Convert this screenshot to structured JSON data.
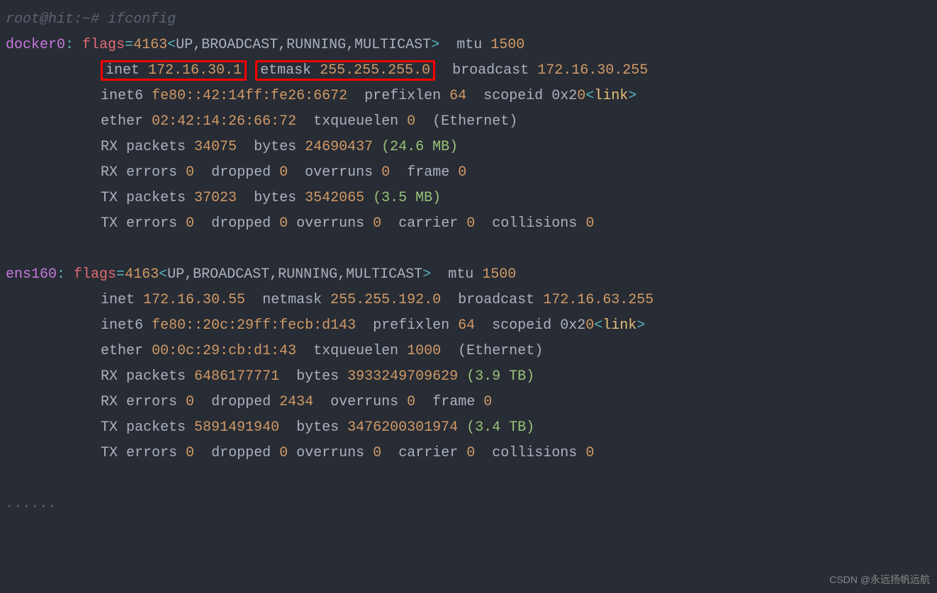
{
  "prompt": {
    "user": "root@hit",
    "path": "~",
    "symbol": "#",
    "command": "ifconfig"
  },
  "ifaces": [
    {
      "name": "docker0",
      "flags_label": "flags",
      "flags_num": "4163",
      "flags_list": "UP,BROADCAST,RUNNING,MULTICAST",
      "mtu_label": "mtu",
      "mtu": "1500",
      "inet_label": "inet",
      "inet": "172.16.30.1",
      "netmask_label": "netmask",
      "netmask_frag": "etmask",
      "netmask": "255.255.255.0",
      "broadcast_label": "broadcast",
      "broadcast": "172.16.30.255",
      "inet6_label": "inet6",
      "inet6": "fe80::42:14ff:fe26:6672",
      "prefixlen_label": "prefixlen",
      "prefixlen": "64",
      "scopeid_label": "scopeid",
      "scopeid_pre": "0x2",
      "scopeid_z": "0",
      "link_lt": "<",
      "link_text": "link",
      "link_gt": ">",
      "ether_label": "ether",
      "ether": "02:42:14:26:66:72",
      "txql_label": "txqueuelen",
      "txql": "0",
      "media": "(Ethernet)",
      "rx_packets_label": "RX packets",
      "rx_packets": "34075",
      "rx_bytes_label": "bytes",
      "rx_bytes": "24690437",
      "rx_bytes_h": "(24.6 MB)",
      "rx_err_label": "RX errors",
      "rx_err": "0",
      "rx_drop_label": "dropped",
      "rx_drop": "0",
      "rx_over_label": "overruns",
      "rx_over": "0",
      "rx_frame_label": "frame",
      "rx_frame": "0",
      "tx_packets_label": "TX packets",
      "tx_packets": "37023",
      "tx_bytes_label": "bytes",
      "tx_bytes": "3542065",
      "tx_bytes_h": "(3.5 MB)",
      "tx_err_label": "TX errors",
      "tx_err": "0",
      "tx_drop_label": "dropped",
      "tx_drop": "0",
      "tx_over_label": "overruns",
      "tx_over": "0",
      "tx_carr_label": "carrier",
      "tx_carr": "0",
      "tx_coll_label": "collisions",
      "tx_coll": "0"
    },
    {
      "name": "ens160",
      "flags_label": "flags",
      "flags_num": "4163",
      "flags_list": "UP,BROADCAST,RUNNING,MULTICAST",
      "mtu_label": "mtu",
      "mtu": "1500",
      "inet_label": "inet",
      "inet": "172.16.30.55",
      "netmask_label": "netmask",
      "netmask": "255.255.192.0",
      "broadcast_label": "broadcast",
      "broadcast": "172.16.63.255",
      "inet6_label": "inet6",
      "inet6": "fe80::20c:29ff:fecb:d143",
      "prefixlen_label": "prefixlen",
      "prefixlen": "64",
      "scopeid_label": "scopeid",
      "scopeid_pre": "0x2",
      "scopeid_z": "0",
      "link_lt": "<",
      "link_text": "link",
      "link_gt": ">",
      "ether_label": "ether",
      "ether": "00:0c:29:cb:d1:43",
      "txql_label": "txqueuelen",
      "txql": "1000",
      "media": "(Ethernet)",
      "rx_packets_label": "RX packets",
      "rx_packets": "6486177771",
      "rx_bytes_label": "bytes",
      "rx_bytes": "3933249709629",
      "rx_bytes_h": "(3.9 TB)",
      "rx_err_label": "RX errors",
      "rx_err": "0",
      "rx_drop_label": "dropped",
      "rx_drop": "2434",
      "rx_over_label": "overruns",
      "rx_over": "0",
      "rx_frame_label": "frame",
      "rx_frame": "0",
      "tx_packets_label": "TX packets",
      "tx_packets": "5891491940",
      "tx_bytes_label": "bytes",
      "tx_bytes": "3476200301974",
      "tx_bytes_h": "(3.4 TB)",
      "tx_err_label": "TX errors",
      "tx_err": "0",
      "tx_drop_label": "dropped",
      "tx_drop": "0",
      "tx_over_label": "overruns",
      "tx_over": "0",
      "tx_carr_label": "carrier",
      "tx_carr": "0",
      "tx_coll_label": "collisions",
      "tx_coll": "0"
    }
  ],
  "ellipsis": "......",
  "watermark": "CSDN @永远扬帆远航"
}
